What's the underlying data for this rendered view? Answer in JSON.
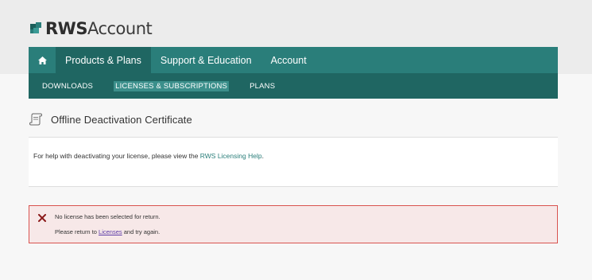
{
  "brand": {
    "name_bold": "RWS",
    "name_light": "Account"
  },
  "nav": {
    "home_icon": "home-icon",
    "items": [
      "Products & Plans",
      "Support & Education",
      "Account"
    ],
    "active_index": 0
  },
  "subnav": {
    "items": [
      "DOWNLOADS",
      "LICENSES & SUBSCRIPTIONS",
      "PLANS"
    ],
    "active_index": 1
  },
  "page": {
    "title": "Offline Deactivation Certificate",
    "title_icon": "certificate-icon"
  },
  "info": {
    "text_before": "For help with deactivating your license, please view the ",
    "link": "RWS Licensing Help",
    "text_after": "."
  },
  "error": {
    "icon": "error-x-icon",
    "line1": "No license has been selected for return.",
    "line2_before": "Please return to ",
    "line2_link": "Licenses",
    "line2_after": " and try again."
  },
  "colors": {
    "nav_primary": "#2a7e7a",
    "nav_dark": "#1f6662",
    "link": "#2a7e7a",
    "error_border": "#d9534f",
    "error_bg": "#f7e8e8",
    "error_icon": "#8b1a1a"
  }
}
